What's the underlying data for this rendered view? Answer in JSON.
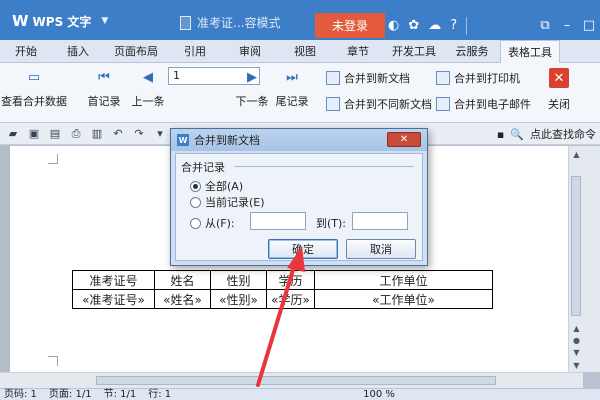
{
  "titlebar": {
    "app_name": "WPS 文字",
    "logo": "W",
    "doc_title": "准考证...容模式",
    "login_label": "未登录",
    "icons": [
      "skin-icon",
      "settings-icon",
      "cloud-icon",
      "help-icon",
      "restore-icon",
      "minimize-icon",
      "maximize-icon"
    ]
  },
  "tabs": [
    "开始",
    "插入",
    "页面布局",
    "引用",
    "审阅",
    "视图",
    "章节",
    "开发工具",
    "云服务",
    "表格工具"
  ],
  "active_tab": "表格工具",
  "ribbon": {
    "view_merge": "查看合并数据",
    "first": "首记录",
    "prev": "上一条",
    "record_value": "1",
    "next": "下一条",
    "last": "尾记录",
    "merge_new_doc": "合并到新文档",
    "merge_diff_doc": "合并到不同新文档",
    "merge_printer": "合并到打印机",
    "merge_email": "合并到电子邮件",
    "close": "关闭"
  },
  "qat": {
    "cmd_search": "点此查找命令"
  },
  "dialog": {
    "title": "合并到新文档",
    "group_label": "合并记录",
    "opt_all": "全部(A)",
    "opt_current": "当前记录(E)",
    "opt_from": "从(F):",
    "to_label": "到(T):",
    "ok": "确定",
    "cancel": "取消",
    "selected": "all"
  },
  "table": {
    "headers": [
      "准考证号",
      "姓名",
      "性别",
      "学历",
      "工作单位"
    ],
    "fields": [
      "«准考证号»",
      "«姓名»",
      "«性别»",
      "«学历»",
      "«工作单位»"
    ]
  },
  "status": {
    "line": "页码: 1",
    "page": "页面: 1/1",
    "section": "节: 1/1",
    "row": "行: 1",
    "zoom": "100 %"
  },
  "colors": {
    "accent": "#3d7ec9",
    "login": "#e35a3c",
    "annotation_arrow": "#e8363c"
  }
}
